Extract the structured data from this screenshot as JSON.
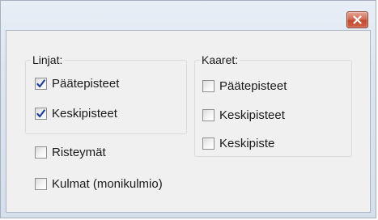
{
  "titlebar": {
    "close_icon": "close-icon"
  },
  "lines_group": {
    "label": "Linjat:",
    "items": [
      {
        "label": "Päätepisteet",
        "checked": true
      },
      {
        "label": "Keskipisteet",
        "checked": true
      }
    ]
  },
  "standalone": {
    "items": [
      {
        "label": "Risteymät",
        "checked": false
      },
      {
        "label": "Kulmat (monikulmio)",
        "checked": false
      }
    ]
  },
  "arcs_group": {
    "label": "Kaaret:",
    "items": [
      {
        "label": "Päätepisteet",
        "checked": false
      },
      {
        "label": "Keskipisteet",
        "checked": false
      },
      {
        "label": "Keskipiste",
        "checked": false
      }
    ]
  },
  "colors": {
    "checkmark": "#1f3f9c",
    "close_button": "#c9533a"
  }
}
